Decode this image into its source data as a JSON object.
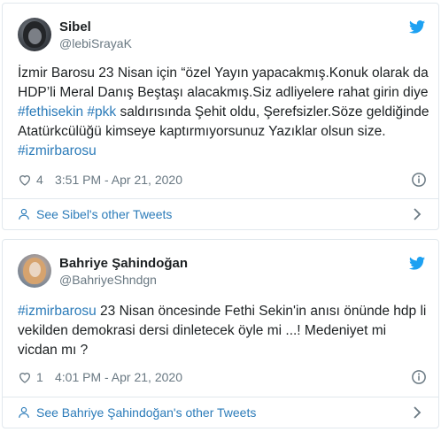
{
  "colors": {
    "link": "#2b7bb9",
    "muted": "#697882",
    "border": "#e1e8ed",
    "twitter": "#1da1f2"
  },
  "tweets": [
    {
      "name": "Sibel",
      "handle": "@lebiSrayaK",
      "segments": [
        {
          "text": "İzmir Barosu 23 Nisan için “özel Yayın yapacakmış.Konuk olarak da HDP’li Meral Danış Beştaşı alacakmış.Siz adliyelere rahat girin diye ",
          "tag": false
        },
        {
          "text": "#fethisekin",
          "tag": true
        },
        {
          "text": " ",
          "tag": false
        },
        {
          "text": "#pkk",
          "tag": true
        },
        {
          "text": " saldırısında Şehit oldu, Şerefsizler.Söze geldiğinde Atatürkcülüğü kimseye kaptırmıyorsunuz Yazıklar olsun size. ",
          "tag": false
        },
        {
          "text": "#izmirbarosu",
          "tag": true
        }
      ],
      "likes": "4",
      "time": "3:51 PM - Apr 21, 2020",
      "other_tweets": "See Sibel's other Tweets"
    },
    {
      "name": "Bahriye Şahindoğan",
      "handle": "@BahriyeShndgn",
      "segments": [
        {
          "text": "#izmirbarosu",
          "tag": true
        },
        {
          "text": " 23 Nisan öncesinde Fethi Sekin'in anısı önünde hdp li vekilden demokrasi dersi dinletecek öyle mi ...! Medeniyet mi vicdan mı ?",
          "tag": false
        }
      ],
      "likes": "1",
      "time": "4:01 PM - Apr 21, 2020",
      "other_tweets": "See Bahriye Şahindoğan's other Tweets"
    }
  ]
}
